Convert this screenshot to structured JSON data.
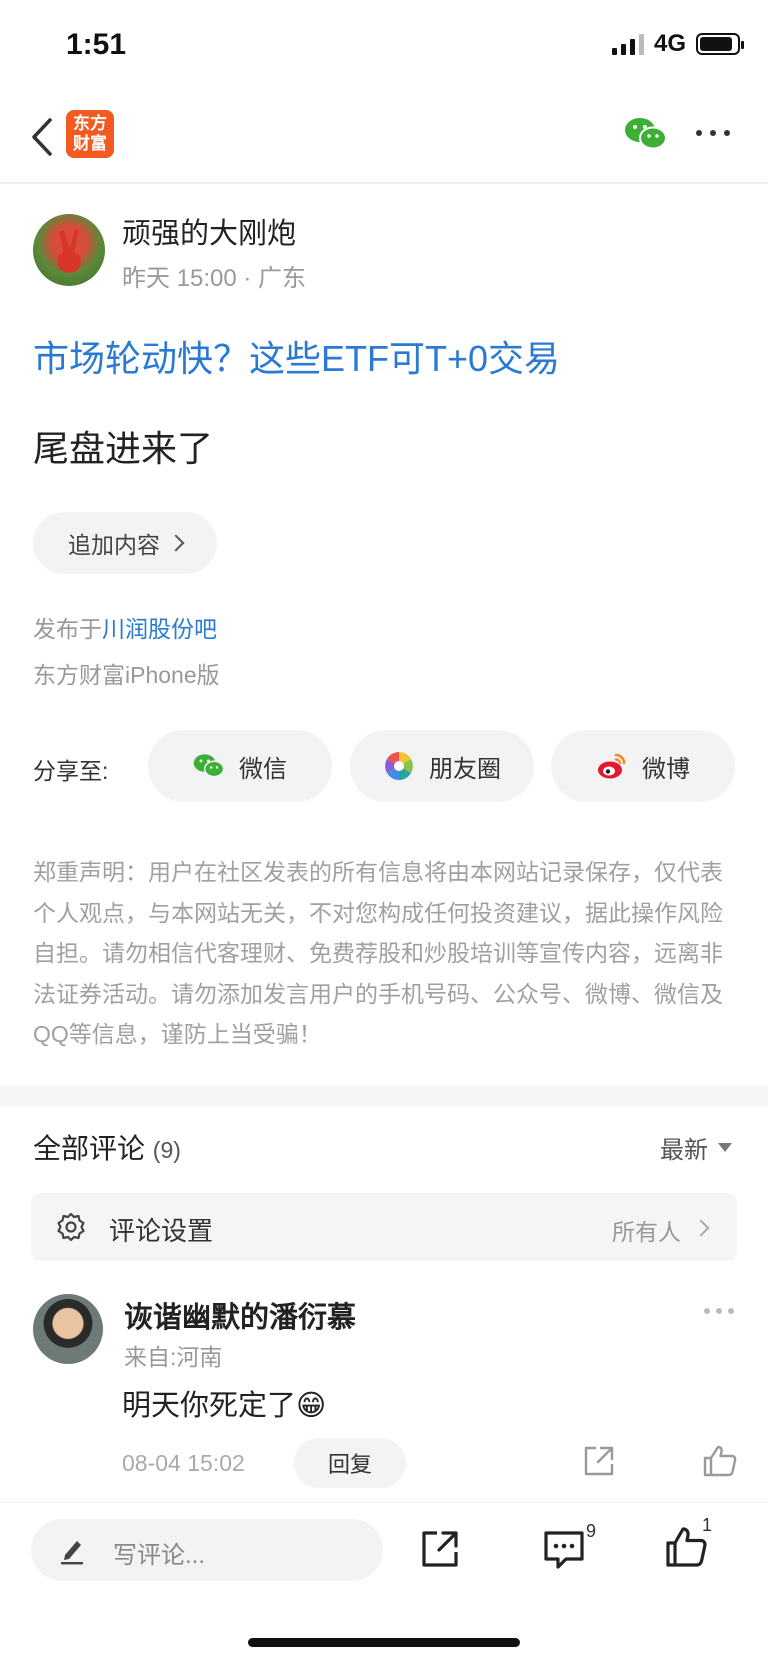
{
  "status_bar": {
    "time": "1:51",
    "network": "4G"
  },
  "nav": {
    "logo_text_line1": "东方",
    "logo_text_line2": "财富"
  },
  "post": {
    "author": "顽强的大刚炮",
    "meta": "昨天 15:00 · 广东",
    "title": "市场轮动快？这些ETF可T+0交易",
    "body": "尾盘进来了",
    "append_label": "追加内容",
    "posted_in_prefix": "发布于",
    "posted_in_link": "川润股份吧",
    "client": "东方财富iPhone版"
  },
  "share": {
    "label": "分享至:",
    "options": [
      {
        "label": "微信",
        "icon": "wechat-icon"
      },
      {
        "label": "朋友圈",
        "icon": "moments-icon"
      },
      {
        "label": "微博",
        "icon": "weibo-icon"
      }
    ]
  },
  "disclaimer": "郑重声明：用户在社区发表的所有信息将由本网站记录保存，仅代表个人观点，与本网站无关，不对您构成任何投资建议，据此操作风险自担。请勿相信代客理财、免费荐股和炒股培训等宣传内容，远离非法证券活动。请勿添加发言用户的手机号码、公众号、微博、微信及QQ等信息，谨防上当受骗！",
  "comments": {
    "title": "全部评论",
    "count": "(9)",
    "sort": "最新",
    "settings_label": "评论设置",
    "settings_value": "所有人",
    "items": [
      {
        "name": "诙谐幽默的潘衍慕",
        "from": "来自:河南",
        "text": "明天你死定了😁",
        "time": "08-04 15:02",
        "reply_label": "回复"
      }
    ]
  },
  "bottom_bar": {
    "write_placeholder": "写评论...",
    "comment_count": "9",
    "like_count": "1"
  },
  "colors": {
    "brand": "#f25a20",
    "link": "#2a7ad3",
    "wechat": "#3cb034"
  }
}
